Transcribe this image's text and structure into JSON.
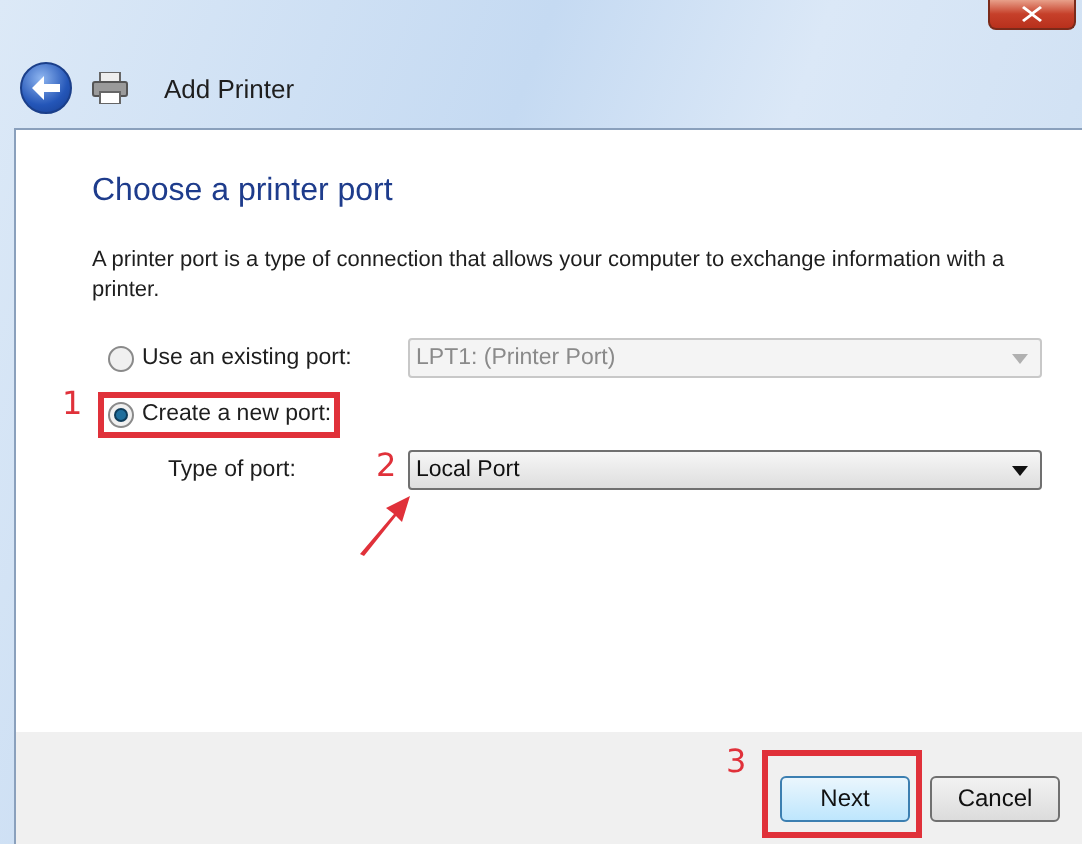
{
  "window": {
    "title": "Add Printer"
  },
  "heading": "Choose a printer port",
  "description": "A printer port is a type of connection that allows your computer to exchange information with a printer.",
  "options": [
    {
      "label": "Use an existing port:",
      "selected": false,
      "dropdown": {
        "value": "LPT1: (Printer Port)",
        "disabled": true
      }
    },
    {
      "label": "Create a new port:",
      "selected": true,
      "marker": {
        "number": "1",
        "kind": "box"
      }
    }
  ],
  "port_type": {
    "label": "Type of port:",
    "dropdown": {
      "value": "Local Port",
      "disabled": false
    },
    "marker": {
      "number": "2",
      "kind": "arrow"
    }
  },
  "buttons": [
    {
      "label": "Next",
      "default": true,
      "marker": {
        "number": "3",
        "kind": "box"
      }
    },
    {
      "label": "Cancel",
      "default": false
    }
  ]
}
